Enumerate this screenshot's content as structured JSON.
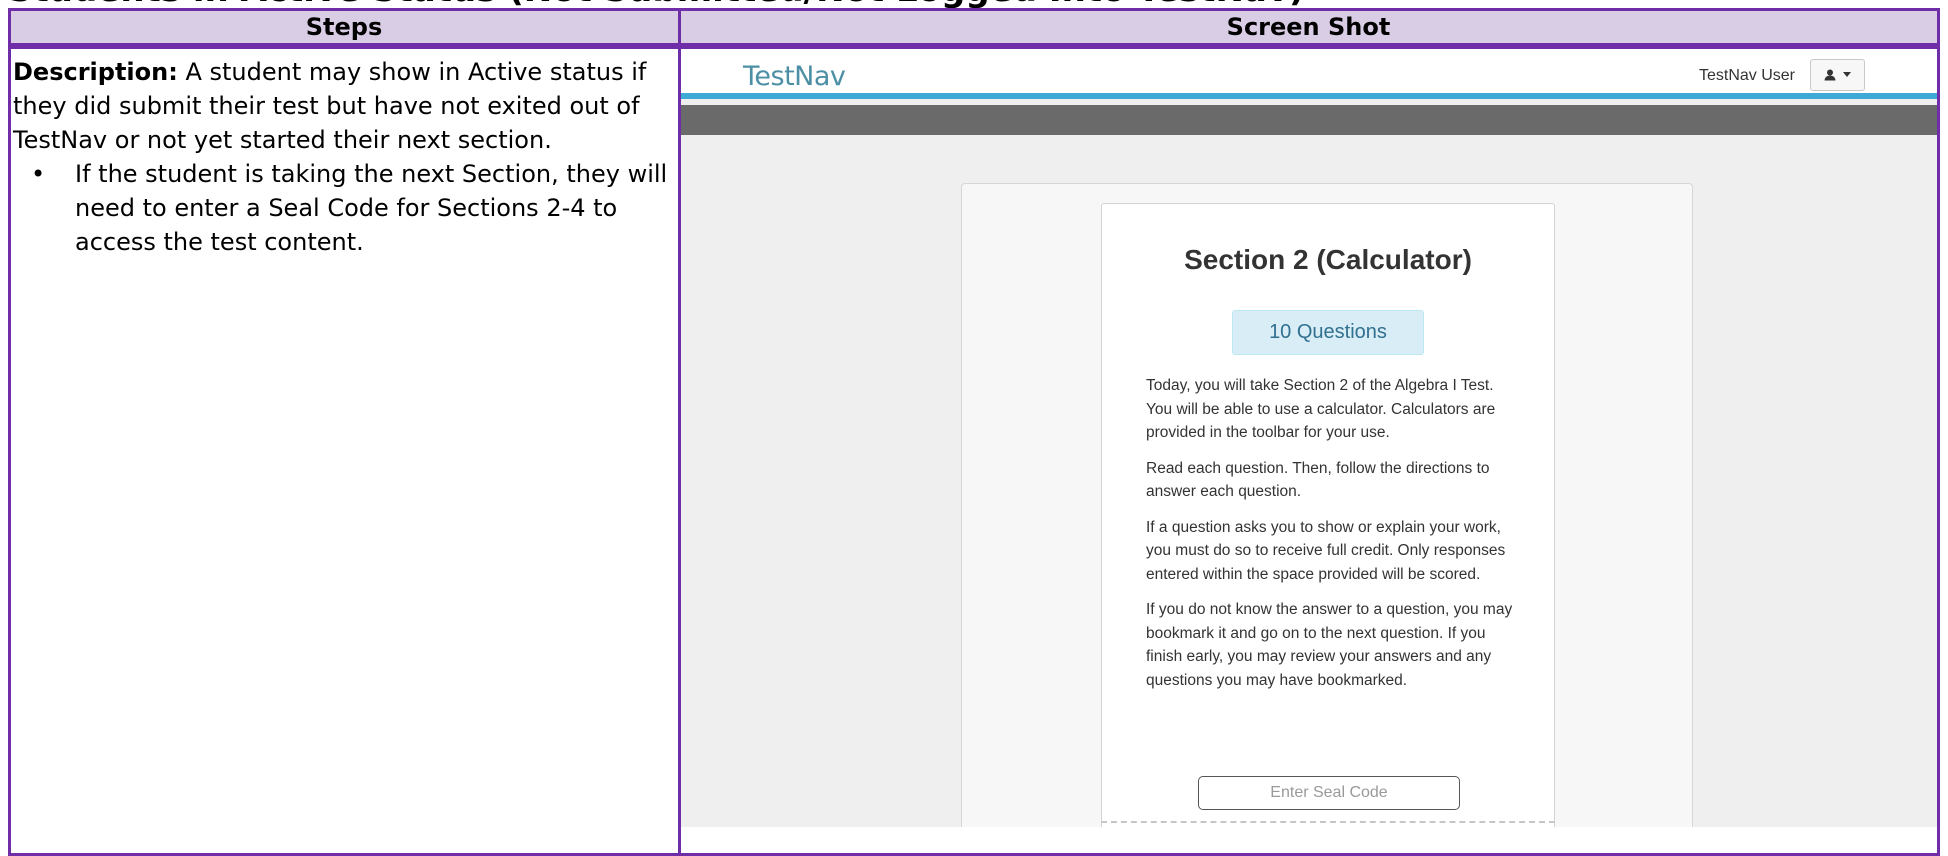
{
  "page_heading": "Students in Active Status (Not Submitted/Not Logged Into TestNav)",
  "table": {
    "headers": {
      "steps": "Steps",
      "screenshot": "Screen Shot"
    }
  },
  "steps": {
    "description_label": "Description:",
    "description_text": " A student may show in Active status if they did submit their test but have not exited out of TestNav or not yet started their next section.",
    "bullets": [
      "If the student is taking the next Section, they will need to enter a Seal Code for Sections 2-4 to access the test content."
    ]
  },
  "screenshot": {
    "app_logo": "TestNav",
    "user_label": "TestNav User",
    "user_icon": "user-icon",
    "card": {
      "title": "Section 2 (Calculator)",
      "questions_badge": "10 Questions",
      "paragraphs": [
        "Today, you will take Section 2 of the Algebra I Test. You will be able to use a calculator. Calculators are provided in the toolbar for your use.",
        "Read each question. Then, follow the directions to answer each question.",
        "If a question asks you to show or explain your work, you must do so to receive full credit. Only responses entered within the space provided will be scored.",
        "If you do not know the answer to a question, you may bookmark it and go on to the next question. If you finish early, you may review your answers and any questions you may have bookmarked."
      ],
      "seal_placeholder": "Enter Seal Code"
    }
  },
  "colors": {
    "table_border": "#6f2da8",
    "header_fill": "#d9cde6",
    "testnav_accent": "#3fa9d5",
    "badge_fill": "#d9edf7"
  }
}
